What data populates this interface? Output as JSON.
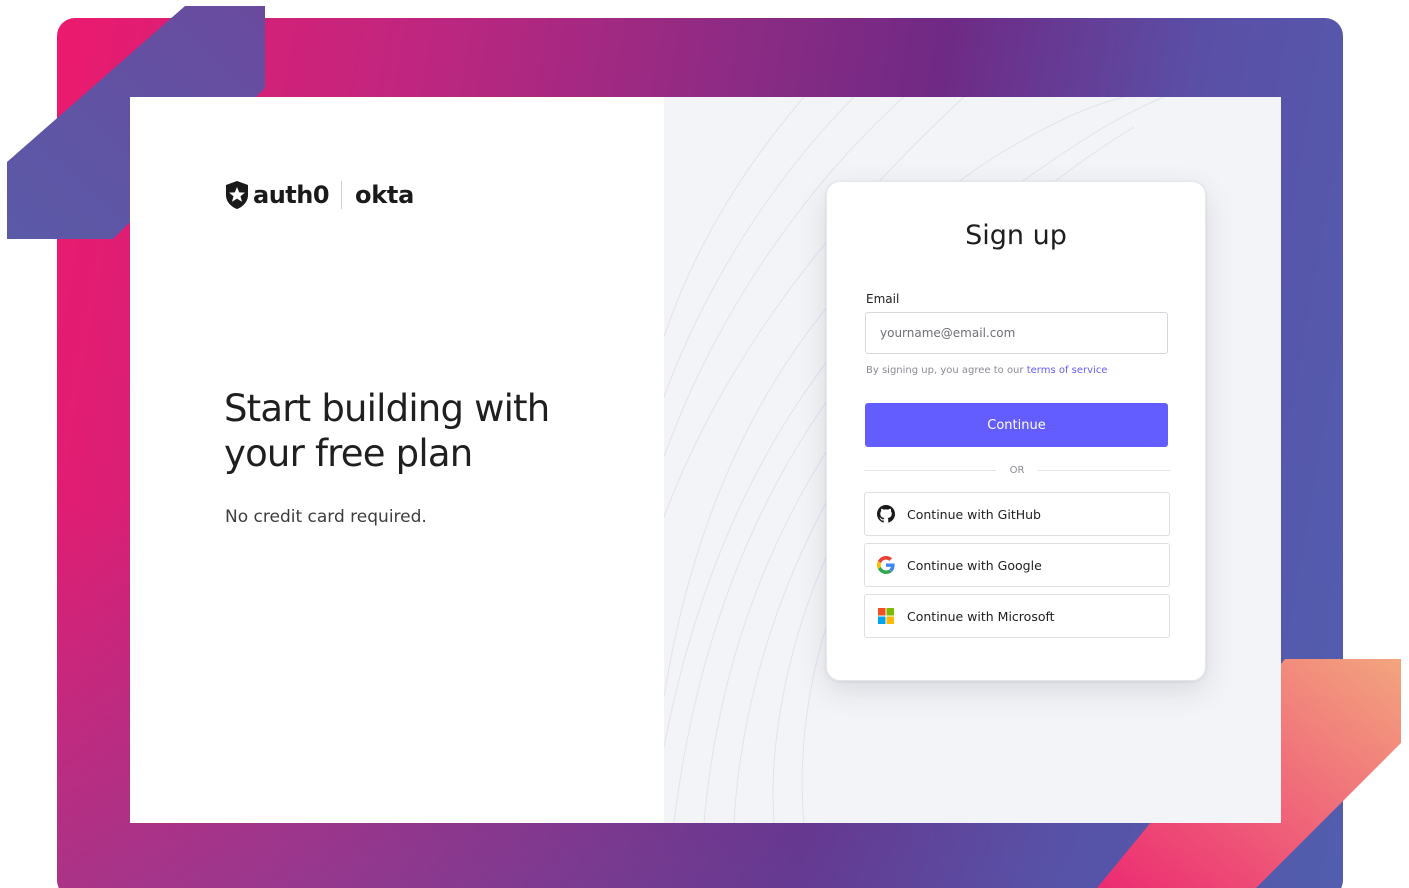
{
  "brand": {
    "logo_primary": "auth0",
    "logo_secondary": "okta",
    "logo_icon": "auth0-shield-icon"
  },
  "hero": {
    "headline_line1": "Start building with",
    "headline_line2": "your free plan",
    "subtext": "No credit card required."
  },
  "signup": {
    "title": "Sign up",
    "email_label": "Email",
    "email_placeholder": "yourname@email.com",
    "email_value": "",
    "terms_prefix": "By signing up, you agree to our ",
    "terms_link": "terms of service",
    "continue_label": "Continue",
    "divider_label": "OR",
    "social": [
      {
        "label": "Continue with GitHub",
        "icon": "github-icon"
      },
      {
        "label": "Continue with Google",
        "icon": "google-icon"
      },
      {
        "label": "Continue with Microsoft",
        "icon": "microsoft-icon"
      }
    ]
  },
  "colors": {
    "accent": "#635dff",
    "frame_gradient_start": "#ec1a6e",
    "frame_gradient_end": "#525fb0",
    "right_panel_bg": "#f3f4f7"
  }
}
